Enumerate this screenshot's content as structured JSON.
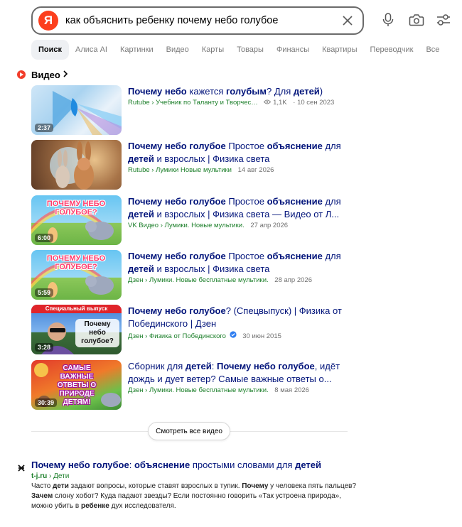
{
  "search": {
    "logo": "Я",
    "query": "как объяснить ребенку почему небо голубое"
  },
  "tabs": [
    "Поиск",
    "Алиса AI",
    "Картинки",
    "Видео",
    "Карты",
    "Товары",
    "Финансы",
    "Квартиры",
    "Переводчик",
    "Все"
  ],
  "video_section": {
    "title": "Видео",
    "show_all": "Смотреть все видео"
  },
  "videos": [
    {
      "duration": "2:37",
      "title_parts": [
        [
          "b",
          "Почему небо"
        ],
        [
          "",
          "кажется"
        ],
        [
          "b",
          "голубым"
        ],
        [
          "",
          "? Для"
        ],
        [
          "b",
          "детей"
        ],
        [
          "",
          ")"
        ]
      ],
      "source": "Rutube › Учебник по Таланту и Творчес…",
      "views": "1,1K",
      "date": "10 сен 2023"
    },
    {
      "duration": "",
      "title_parts": [
        [
          "b",
          "Почему небо голубое"
        ],
        [
          "",
          "Простое"
        ],
        [
          "b",
          "объяснение"
        ],
        [
          "",
          "для"
        ],
        [
          "b",
          "детей"
        ],
        [
          "",
          "и взрослых | Физика света"
        ]
      ],
      "source": "Rutube › Лумики Новые мультики",
      "date": "14 авг 2026"
    },
    {
      "duration": "6:00",
      "thumb_text": "ПОЧЕМУ НЕБО ГОЛУБОЕ?",
      "title_parts": [
        [
          "b",
          "Почему небо голубое"
        ],
        [
          "",
          "Простое"
        ],
        [
          "b",
          "объяснение"
        ],
        [
          "",
          "для"
        ],
        [
          "b",
          "детей"
        ],
        [
          "",
          "и взрослых | Физика света — Видео от Л..."
        ]
      ],
      "source": "VK Видео › Лумики. Новые мультики.",
      "date": "27 апр 2026"
    },
    {
      "duration": "5:59",
      "thumb_text": "ПОЧЕМУ НЕБО ГОЛУБОЕ?",
      "title_parts": [
        [
          "b",
          "Почему небо голубое"
        ],
        [
          "",
          "Простое"
        ],
        [
          "b",
          "объяснение"
        ],
        [
          "",
          "для"
        ],
        [
          "b",
          "детей"
        ],
        [
          "",
          "и взрослых | Физика света"
        ]
      ],
      "source": "Дзен › Лумики. Новые бесплатные мультики.",
      "date": "28 апр 2026"
    },
    {
      "duration": "3:28",
      "thumb_banner": "Специальный выпуск",
      "thumb_text": "Почему небо голубое?",
      "title_parts": [
        [
          "b",
          "Почему небо голубое"
        ],
        [
          "",
          "? (Спецвыпуск) | Физика от Побединского | Дзен"
        ]
      ],
      "source": "Дзен › Физика от Побединского",
      "date": "30 июн 2015"
    },
    {
      "duration": "30:39",
      "thumb_text": "САМЫЕ ВАЖНЫЕ ОТВЕТЫ О ПРИРОДЕ ДЕТЯМ!",
      "title_parts": [
        [
          "",
          "Сборник для"
        ],
        [
          "b",
          "детей"
        ],
        [
          "",
          ":"
        ],
        [
          "b",
          "Почему небо голубое"
        ],
        [
          "",
          ", идёт дождь и дует ветер? Самые важные ответы о..."
        ]
      ],
      "source": "Дзен › Лумики. Новые бесплатные мультики.",
      "date": "8 мая 2026"
    }
  ],
  "result": {
    "title_parts": [
      [
        "b",
        "Почему небо голубое"
      ],
      [
        "",
        ":"
      ],
      [
        "b",
        "объяснение"
      ],
      [
        "",
        "простыми словами для"
      ],
      [
        "b",
        "детей"
      ]
    ],
    "domain": "t-j.ru",
    "breadcrumb": "› Дети",
    "snippet_parts": [
      [
        "",
        "Часто"
      ],
      [
        "b",
        "дети"
      ],
      [
        "",
        "задают вопросы, которые ставят взрослых в тупик."
      ],
      [
        "b",
        "Почему"
      ],
      [
        "",
        "у человека пять пальцев?"
      ],
      [
        "b",
        "Зачем"
      ],
      [
        "",
        "слону хобот? Куда падают звезды? Если постоянно говорить «Так устроена природа», можно убить в"
      ],
      [
        "b",
        "ребенке"
      ],
      [
        "",
        "дух исследователя."
      ]
    ]
  },
  "colors": {
    "brand": "#fc3f1d",
    "link": "#00137a",
    "source": "#1c7f2a"
  }
}
